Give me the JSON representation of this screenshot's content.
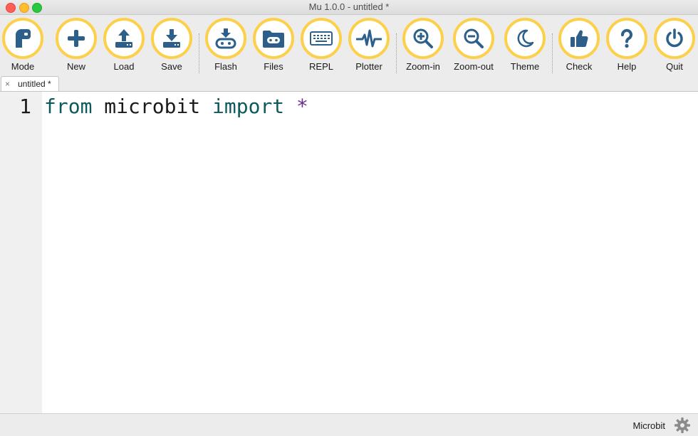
{
  "window": {
    "title": "Mu 1.0.0 - untitled *"
  },
  "toolbar": {
    "buttons": [
      {
        "id": "mode",
        "label": "Mode",
        "icon": "mode-icon"
      },
      {
        "id": "new",
        "label": "New",
        "icon": "plus-icon"
      },
      {
        "id": "load",
        "label": "Load",
        "icon": "upload-icon"
      },
      {
        "id": "save",
        "label": "Save",
        "icon": "download-icon"
      },
      {
        "id": "flash",
        "label": "Flash",
        "icon": "flash-icon"
      },
      {
        "id": "files",
        "label": "Files",
        "icon": "folder-icon"
      },
      {
        "id": "repl",
        "label": "REPL",
        "icon": "keyboard-icon"
      },
      {
        "id": "plotter",
        "label": "Plotter",
        "icon": "pulse-icon"
      },
      {
        "id": "zoom-in",
        "label": "Zoom-in",
        "icon": "zoom-in-icon"
      },
      {
        "id": "zoom-out",
        "label": "Zoom-out",
        "icon": "zoom-out-icon"
      },
      {
        "id": "theme",
        "label": "Theme",
        "icon": "moon-icon"
      },
      {
        "id": "check",
        "label": "Check",
        "icon": "thumbs-up-icon"
      },
      {
        "id": "help",
        "label": "Help",
        "icon": "question-icon"
      },
      {
        "id": "quit",
        "label": "Quit",
        "icon": "power-icon"
      }
    ]
  },
  "tabs": [
    {
      "label": "untitled *",
      "close": "×"
    }
  ],
  "editor": {
    "lines": [
      {
        "number": "1",
        "tokens": [
          "from",
          "microbit",
          "import",
          "*"
        ]
      }
    ]
  },
  "statusbar": {
    "mode": "Microbit",
    "settings_icon": "gear-icon"
  },
  "colors": {
    "accent": "#fdd04c",
    "icon": "#2c5f8a",
    "keyword": "#0d5a5a",
    "operator": "#6b2d8f"
  }
}
